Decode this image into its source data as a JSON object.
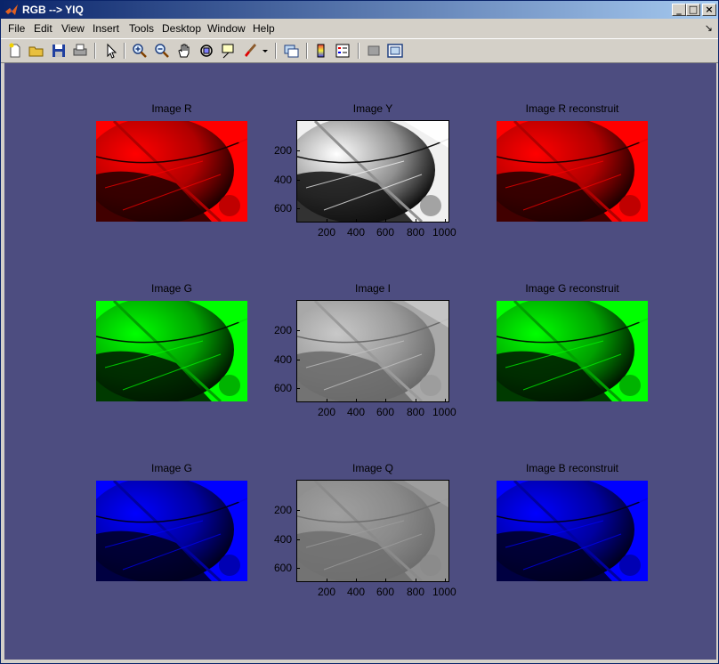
{
  "window": {
    "title": "RGB --> YIQ",
    "minimize": "_",
    "maximize": "□",
    "close": "×"
  },
  "menu": [
    "File",
    "Edit",
    "View",
    "Insert",
    "Tools",
    "Desktop",
    "Window",
    "Help"
  ],
  "menu_dock": "↘",
  "toolbar": [
    "new-figure",
    "open-file",
    "save",
    "print",
    "edit-plot",
    "zoom-in",
    "zoom-out",
    "pan",
    "rotate-3d",
    "data-cursor",
    "brush",
    "brush-dropdown",
    "link-plot",
    "insert-colorbar",
    "insert-legend",
    "hide-plot-tools",
    "show-plot-tools"
  ],
  "figure_bg": "#4d4d80",
  "axes": [
    {
      "title": "Image R",
      "type": "red"
    },
    {
      "title": "Image Y",
      "type": "gray-y"
    },
    {
      "title": "Image R reconstruit",
      "type": "red"
    },
    {
      "title": "Image G",
      "type": "green"
    },
    {
      "title": "Image I",
      "type": "gray-i"
    },
    {
      "title": "Image G reconstruit",
      "type": "green"
    },
    {
      "title": "Image G",
      "type": "blue"
    },
    {
      "title": "Image Q",
      "type": "gray-q"
    },
    {
      "title": "Image B  reconstruit",
      "type": "blue"
    }
  ],
  "ticks": {
    "x": [
      "200",
      "400",
      "600",
      "800",
      "1000"
    ],
    "y": [
      "200",
      "400",
      "600"
    ]
  }
}
